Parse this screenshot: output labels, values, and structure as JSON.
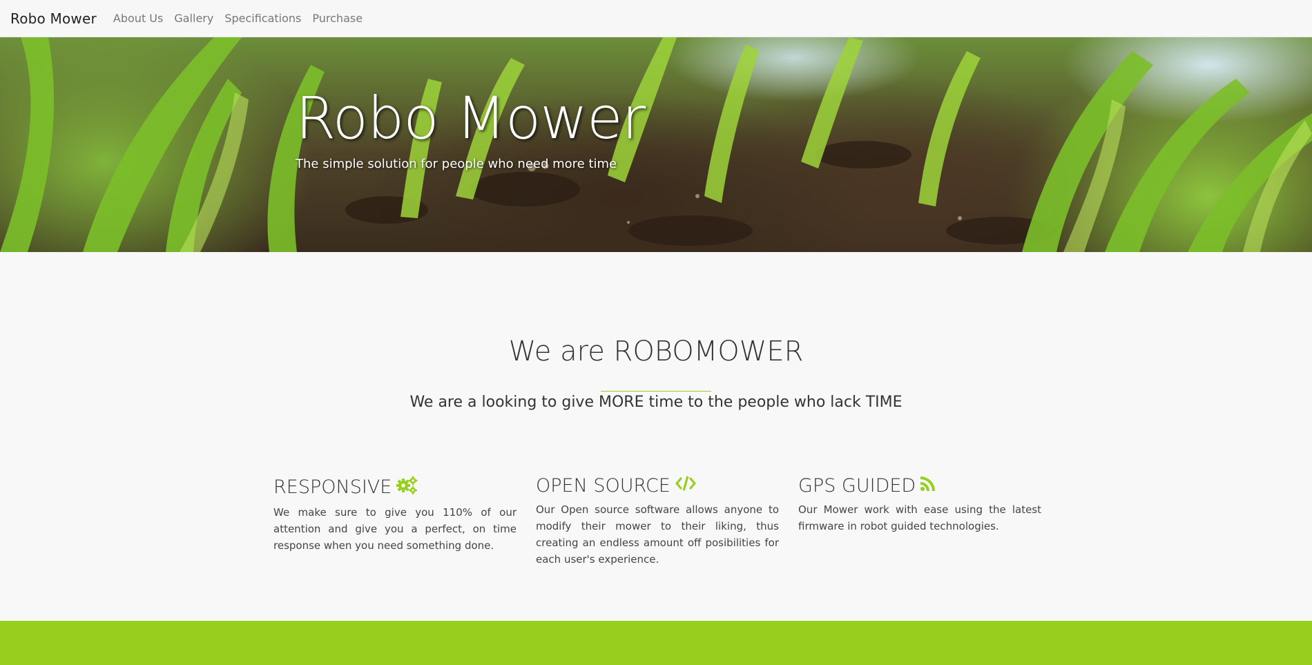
{
  "navbar": {
    "brand": "Robo Mower",
    "links": [
      {
        "label": "About Us"
      },
      {
        "label": "Gallery"
      },
      {
        "label": "Specifications"
      },
      {
        "label": "Purchase"
      }
    ]
  },
  "hero": {
    "title": "Robo Mower",
    "subtitle": "The simple solution for people who need more time"
  },
  "about": {
    "title": "We are ROBOMOWER",
    "lead": "We are a looking to give MORE time to the people who lack TIME"
  },
  "features": [
    {
      "title": "RESPONSIVE",
      "icon": "gears-icon",
      "text": "We make sure to give you 110% of our attention and give you a perfect, on time response when you need something done."
    },
    {
      "title": "OPEN SOURCE",
      "icon": "code-icon",
      "text": "Our Open source software allows anyone to modify their mower to their liking, thus creating an endless amount off posibilities for each user's experience."
    },
    {
      "title": "GPS GUIDED",
      "icon": "rss-icon",
      "text": "Our Mower work with ease using the latest firmware in robot guided technologies."
    }
  ],
  "colors": {
    "accent": "#97cf1f",
    "navbar_bg": "#f7f7f7",
    "page_bg": "#f8f8f8",
    "nav_link": "#777777"
  }
}
